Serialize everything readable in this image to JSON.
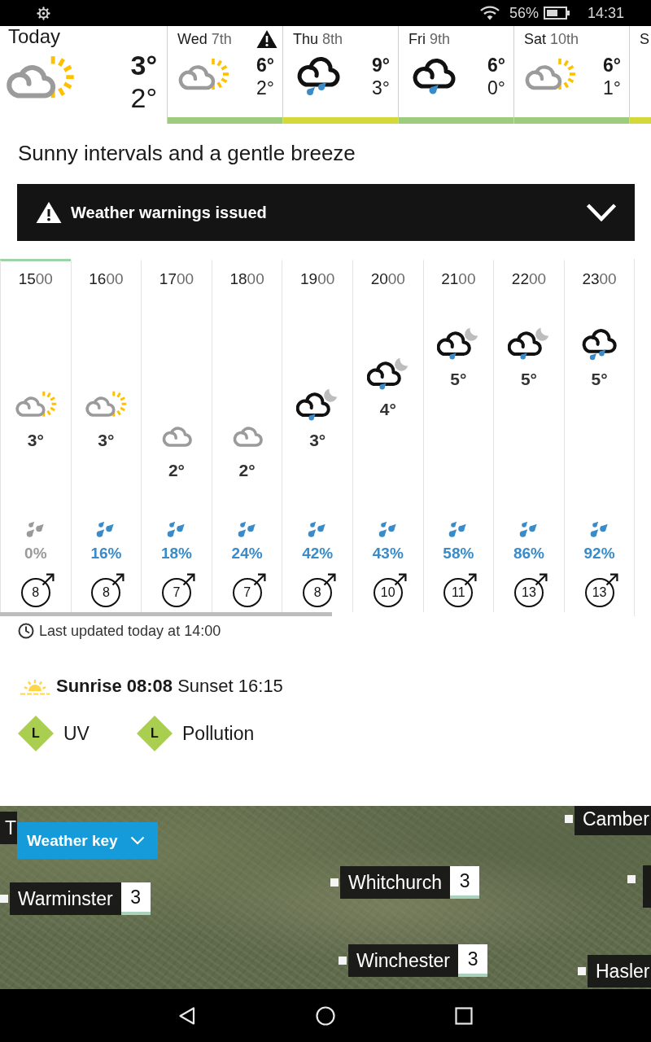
{
  "status_bar": {
    "battery": "56%",
    "time": "14:31"
  },
  "days": [
    {
      "label": "Today",
      "kind": "sunny_intervals",
      "high": "3°",
      "low": "2°"
    },
    {
      "label": "Wed 7th",
      "warning": true,
      "kind": "sunny_intervals",
      "high": "6°",
      "low": "2°",
      "color": "#9ccc7c"
    },
    {
      "label": "Thu 8th",
      "warning": false,
      "kind": "rain",
      "high": "9°",
      "low": "3°",
      "color": "#d3d83b"
    },
    {
      "label": "Fri 9th",
      "warning": false,
      "kind": "light_rain",
      "high": "6°",
      "low": "0°",
      "color": "#9ccc7c"
    },
    {
      "label": "Sat 10th",
      "warning": false,
      "kind": "sunny_intervals",
      "high": "6°",
      "low": "1°",
      "color": "#9ccc7c"
    },
    {
      "label": "S",
      "color": "#d3d83b"
    }
  ],
  "summary": "Sunny intervals and a gentle breeze",
  "warnings_banner": {
    "label": "Weather warnings issued",
    "expanded": false
  },
  "hours": [
    {
      "time": "1500",
      "selected": true,
      "kind": "sunny_intervals",
      "temperature": "3°",
      "rain_chance": "0%",
      "color": "#9a9a9a",
      "wind_speed": "8"
    },
    {
      "time": "1600",
      "selected": false,
      "kind": "sunny_intervals",
      "temperature": "3°",
      "rain_chance": "16%",
      "color": "#3a8bc8",
      "wind_speed": "8"
    },
    {
      "time": "1700",
      "selected": false,
      "kind": "cloudy",
      "temperature": "2°",
      "rain_chance": "18%",
      "color": "#3a8bc8",
      "wind_speed": "7"
    },
    {
      "time": "1800",
      "selected": false,
      "kind": "cloudy",
      "temperature": "2°",
      "rain_chance": "24%",
      "color": "#3a8bc8",
      "wind_speed": "7"
    },
    {
      "time": "1900",
      "selected": false,
      "kind": "rain_night",
      "temperature": "3°",
      "rain_chance": "42%",
      "color": "#3a8bc8",
      "wind_speed": "8"
    },
    {
      "time": "2000",
      "selected": false,
      "kind": "rain_night",
      "temperature": "4°",
      "rain_chance": "43%",
      "color": "#3a8bc8",
      "wind_speed": "10"
    },
    {
      "time": "2100",
      "selected": false,
      "kind": "rain_night",
      "temperature": "5°",
      "rain_chance": "58%",
      "color": "#3a8bc8",
      "wind_speed": "11"
    },
    {
      "time": "2200",
      "selected": false,
      "kind": "rain_night",
      "temperature": "5°",
      "rain_chance": "86%",
      "color": "#3a8bc8",
      "wind_speed": "13"
    },
    {
      "time": "2300",
      "selected": false,
      "kind": "rain",
      "temperature": "5°",
      "rain_chance": "92%",
      "color": "#3a8bc8",
      "wind_speed": "13"
    }
  ],
  "last_updated": "Last updated today at 14:00",
  "sun": "**Sunrise 08:08** Sunset 16:15",
  "indices": [
    {
      "grade": "L",
      "label": "UV",
      "color": "#aacf50"
    },
    {
      "grade": "L",
      "label": "Pollution",
      "color": "#aacf50"
    }
  ],
  "map": {
    "weather_key": {
      "label": "Weather key",
      "expanded": false
    },
    "places": [
      {
        "name": "T"
      },
      {
        "name": "Camber"
      },
      {
        "name": "Warminster",
        "value": "3"
      },
      {
        "name": "Whitchurch",
        "value": "3"
      },
      {
        "name": "Winchester",
        "value": "3"
      },
      {
        "name": "Hasler"
      }
    ]
  }
}
